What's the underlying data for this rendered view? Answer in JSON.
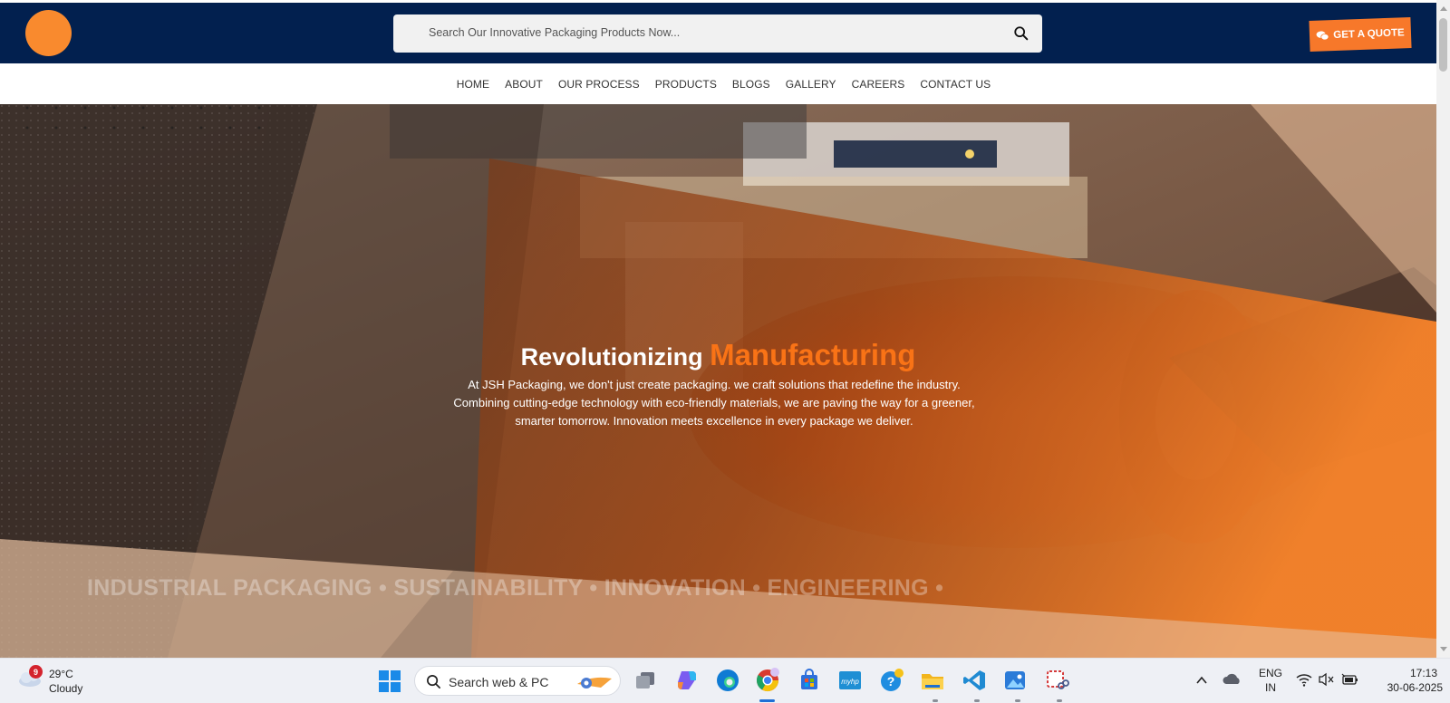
{
  "header": {
    "search_placeholder": "Search Our Innovative Packaging Products Now...",
    "quote_label": "GET A QUOTE"
  },
  "nav": {
    "items": [
      "HOME",
      "ABOUT",
      "OUR PROCESS",
      "PRODUCTS",
      "BLOGS",
      "GALLERY",
      "CAREERS",
      "CONTACT US"
    ]
  },
  "hero": {
    "title_plain": "Revolutionizing",
    "title_accent": "Manufacturing",
    "description_line1": "At JSH Packaging, we don't just create packaging. we craft solutions that redefine the industry.",
    "description_line2": "Combining cutting-edge technology with eco-friendly materials, we are paving the way for a greener,",
    "description_line3": "smarter tomorrow. Innovation meets excellence in every package we deliver.",
    "marquee": "INDUSTRIAL PACKAGING • SUSTAINABILITY • INNOVATION • ENGINEERING •"
  },
  "taskbar": {
    "weather_badge": "9",
    "temperature": "29°C",
    "condition": "Cloudy",
    "search_label": "Search web & PC",
    "language_line1": "ENG",
    "language_line2": "IN",
    "time": "17:13",
    "date": "30-06-2025"
  },
  "colors": {
    "navy": "#02204f",
    "orange": "#f97316",
    "quote_button": "#f7782a"
  },
  "icons": [
    "search-icon",
    "chat-icon",
    "windows-start-icon",
    "task-view-icon",
    "copilot-icon",
    "edge-icon",
    "chrome-icon",
    "store-icon",
    "myhp-icon",
    "help-icon",
    "file-explorer-icon",
    "vscode-icon",
    "photos-icon",
    "snipping-tool-icon",
    "chevron-up-icon",
    "onedrive-icon",
    "wifi-icon",
    "volume-muted-icon",
    "battery-icon"
  ]
}
